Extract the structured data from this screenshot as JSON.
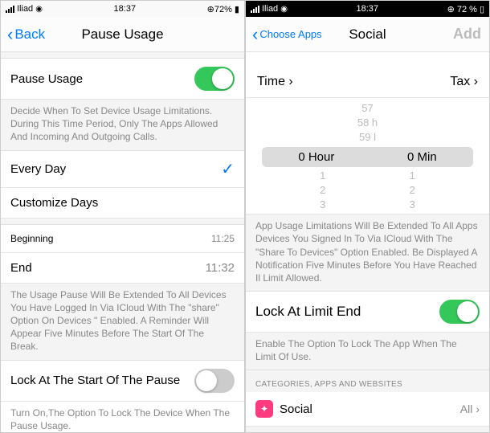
{
  "left": {
    "status": {
      "carrier": "Iliad",
      "time": "18:37",
      "battery": "72%"
    },
    "nav": {
      "back": "Back",
      "title": "Pause Usage"
    },
    "pause_toggle": {
      "label": "Pause Usage"
    },
    "pause_desc": "Decide When To Set Device Usage Limitations. During This Time Period, Only The Apps Allowed And Incoming And Outgoing Calls.",
    "every_day": "Every Day",
    "customize": "Customize Days",
    "beginning": {
      "label": "Beginning",
      "value": "11:25"
    },
    "end": {
      "label": "End",
      "value": "11:32"
    },
    "share_desc": "The Usage Pause Will Be Extended To All Devices You Have Logged In Via ICloud With The \"share\" Option On Devices \" Enabled. A Reminder Will Appear Five Minutes Before The Start Of The Break.",
    "lock": {
      "label": "Lock At The Start Of The Pause"
    },
    "lock_desc": "Turn On,The Option To Lock The Device When The Pause Usage."
  },
  "right": {
    "status": {
      "carrier": "Iliad",
      "time": "18:37",
      "battery": "72 %"
    },
    "nav": {
      "back": "Choose Apps",
      "title": "Social",
      "add": "Add"
    },
    "seg": {
      "time": "Time ›",
      "tax": "Tax ›"
    },
    "picker": {
      "above": [
        "57",
        "58 h",
        "59 l"
      ],
      "sel_hour": "0 Hour",
      "sel_min": "0 Min",
      "below_left": [
        "1",
        "2",
        "3"
      ],
      "below_right": [
        "1",
        "2",
        "3"
      ]
    },
    "limit_desc": "App Usage Limitations Will Be Extended To All Apps Devices You Signed In To Via ICloud With The \"Share To Devices\" Option Enabled. Be Displayed A Notification Five Minutes Before You Have Reached Il Limit Allowed.",
    "lock": {
      "label": "Lock At Limit End"
    },
    "lock_desc": "Enable The Option To Lock The App When The Limit Of Use.",
    "section": "CATEGORIES, APPS AND WEBSITES",
    "cat": {
      "label": "Social",
      "value": "All"
    }
  }
}
